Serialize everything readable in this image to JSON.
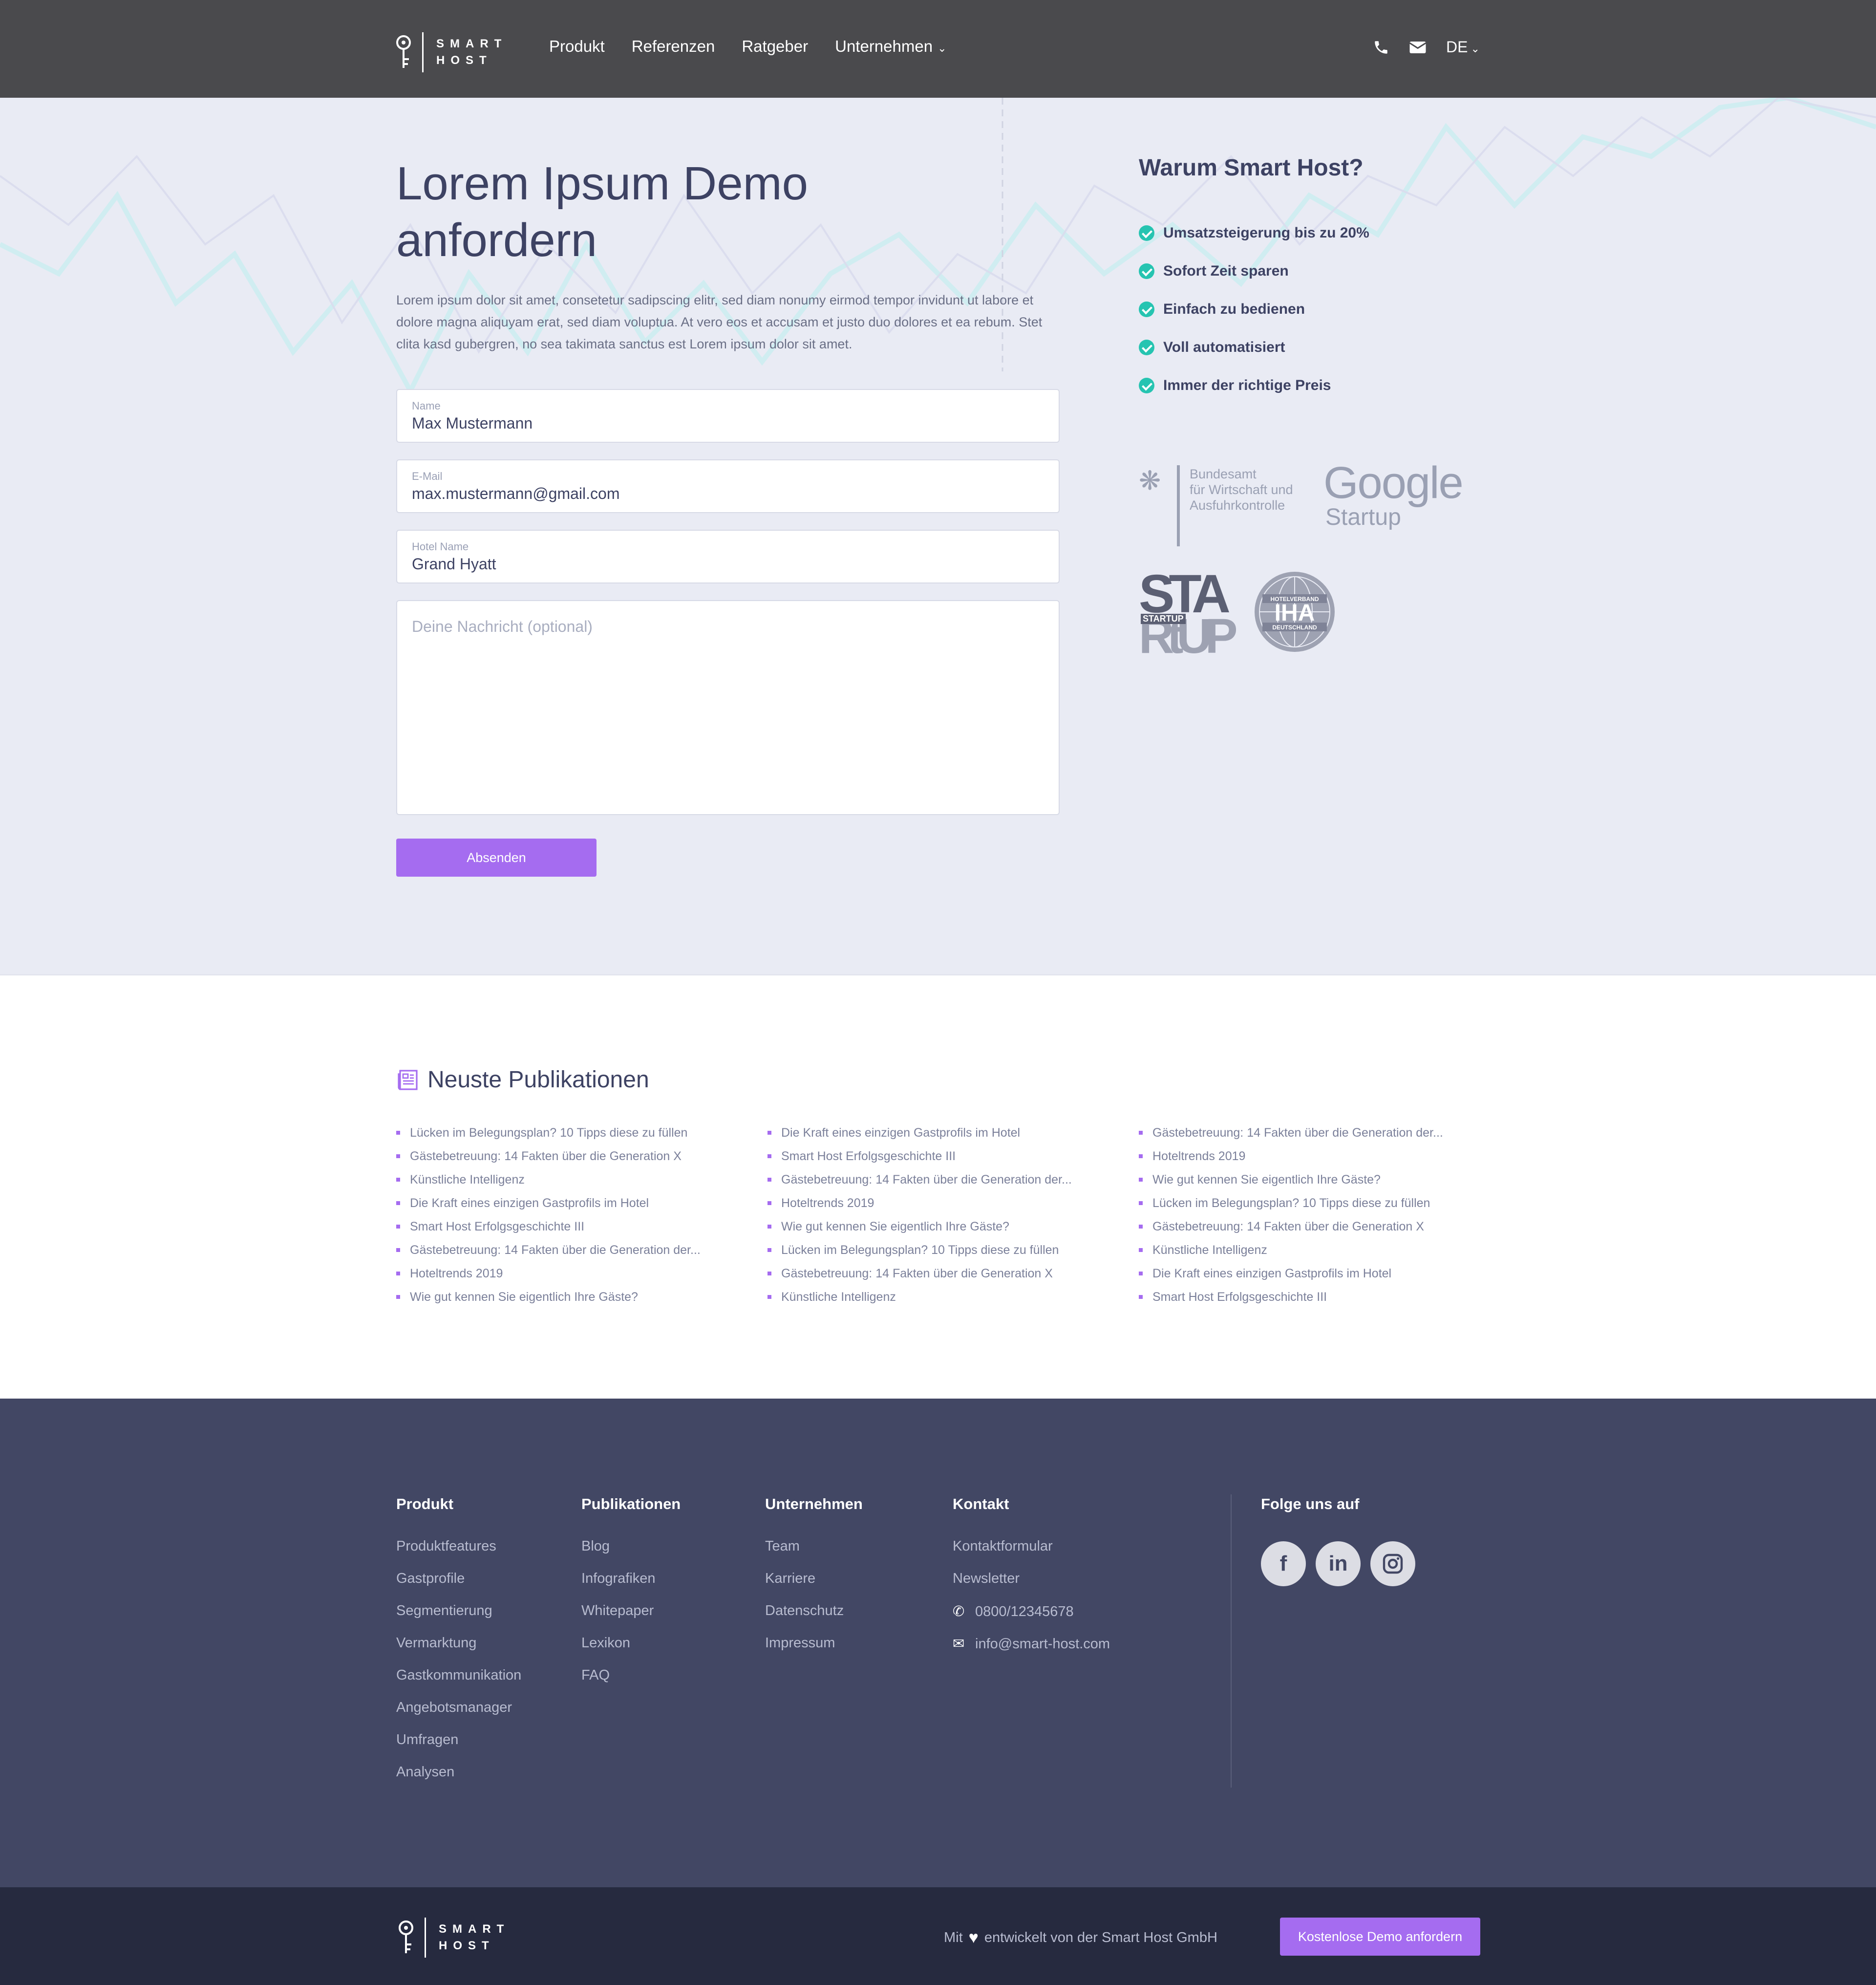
{
  "brand": {
    "line1": "SMART",
    "line2": "HOST"
  },
  "nav": {
    "items": [
      "Produkt",
      "Referenzen",
      "Ratgeber",
      "Unternehmen"
    ],
    "language": "DE"
  },
  "hero": {
    "title": "Lorem Ipsum Demo anfordern",
    "lead": "Lorem ipsum dolor sit amet, consetetur sadipscing elitr, sed diam nonumy eirmod tempor invidunt ut labore et dolore magna aliquyam erat, sed diam voluptua. At vero eos et accusam et justo duo dolores et ea rebum. Stet clita kasd gubergren, no sea takimata sanctus est Lorem ipsum dolor sit amet."
  },
  "form": {
    "name": {
      "label": "Name",
      "value": "Max Mustermann"
    },
    "email": {
      "label": "E-Mail",
      "value": "max.mustermann@gmail.com"
    },
    "hotel": {
      "label": "Hotel Name",
      "value": "Grand Hyatt"
    },
    "message_placeholder": "Deine Nachricht (optional)",
    "submit": "Absenden"
  },
  "why": {
    "title": "Warum Smart Host?",
    "items": [
      "Umsatzsteigerung bis zu 20%",
      "Sofort Zeit sparen",
      "Einfach zu bedienen",
      "Voll automatisiert",
      "Immer der richtige Preis"
    ]
  },
  "partners": {
    "bafa": [
      "Bundesamt",
      "für Wirtschaft und",
      "Ausfuhrkontrolle"
    ],
    "google": [
      "Google",
      "Startup"
    ],
    "startup": {
      "big1": "STA",
      "big2": "RtUP",
      "badge": "STARTUP"
    },
    "iha": {
      "top": "HOTELVERBAND",
      "mid": "IHA",
      "bottom": "DEUTSCHLAND"
    }
  },
  "publications": {
    "title": "Neuste Publikationen",
    "columns": [
      [
        "Lücken im Belegungsplan? 10 Tipps diese zu füllen",
        "Gästebetreuung: 14 Fakten über die Generation X",
        "Künstliche Intelligenz",
        "Die Kraft eines einzigen Gastprofils im Hotel",
        "Smart Host Erfolgsgeschichte III",
        "Gästebetreuung: 14 Fakten über die Generation der...",
        "Hoteltrends 2019",
        "Wie gut kennen Sie eigentlich Ihre Gäste?"
      ],
      [
        "Die Kraft eines einzigen Gastprofils im Hotel",
        "Smart Host Erfolgsgeschichte III",
        "Gästebetreuung: 14 Fakten über die Generation der...",
        "Hoteltrends 2019",
        "Wie gut kennen Sie eigentlich Ihre Gäste?",
        "Lücken im Belegungsplan? 10 Tipps diese zu füllen",
        "Gästebetreuung: 14 Fakten über die Generation X",
        "Künstliche Intelligenz"
      ],
      [
        "Gästebetreuung: 14 Fakten über die Generation der...",
        "Hoteltrends 2019",
        "Wie gut kennen Sie eigentlich Ihre Gäste?",
        "Lücken im Belegungsplan? 10 Tipps diese zu füllen",
        "Gästebetreuung: 14 Fakten über die Generation X",
        "Künstliche Intelligenz",
        "Die Kraft eines einzigen Gastprofils im Hotel",
        "Smart Host Erfolgsgeschichte III"
      ]
    ]
  },
  "footer": {
    "produkt": {
      "title": "Produkt",
      "links": [
        "Produktfeatures",
        "Gastprofile",
        "Segmentierung",
        "Vermarktung",
        "Gastkommunikation",
        "Angebotsmanager",
        "Umfragen",
        "Analysen"
      ]
    },
    "publikationen": {
      "title": "Publikationen",
      "links": [
        "Blog",
        "Infografiken",
        "Whitepaper",
        "Lexikon",
        "FAQ"
      ]
    },
    "unternehmen": {
      "title": "Unternehmen",
      "links": [
        "Team",
        "Karriere",
        "Datenschutz",
        "Impressum"
      ]
    },
    "kontakt": {
      "title": "Kontakt",
      "links": [
        "Kontaktformular",
        "Newsletter"
      ],
      "phone": "0800/12345678",
      "email": "info@smart-host.com"
    },
    "social": {
      "title": "Folge uns auf",
      "facebook": "f",
      "linkedin": "in"
    }
  },
  "bottom": {
    "made_pre": "Mit",
    "made_post": "entwickelt von der Smart Host GmbH",
    "cta": "Kostenlose Demo anfordern"
  },
  "colors": {
    "accent": "#a56cf0",
    "check": "#26c4b1",
    "header": "#4a4a4d",
    "footer": "#424764",
    "bottom": "#262a3f"
  }
}
